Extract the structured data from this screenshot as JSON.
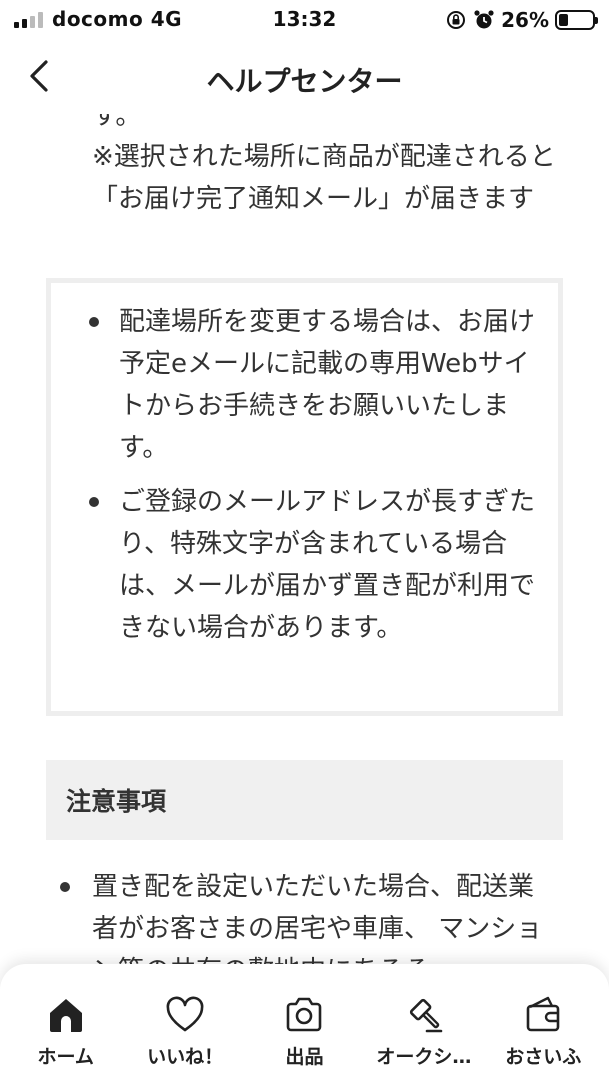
{
  "status_bar": {
    "carrier": "docomo  4G",
    "time": "13:32",
    "battery_percent": "26%",
    "battery_level": 0.26,
    "icons": [
      "signal-icon",
      "orientation-lock-icon",
      "alarm-icon",
      "battery-icon"
    ]
  },
  "header": {
    "title": "ヘルプセンター",
    "back_icon": "chevron-left-icon"
  },
  "content": {
    "cut_line": "す。",
    "note": "※選択された場所に商品が配達されると「お届け完了通知メール」が届きます",
    "info_box": {
      "items": [
        "配達場所を変更する場合は、お届け予定eメールに記載の専用Webサイトからお手続きをお願いいたします。",
        "ご登録のメールアドレスが長すぎたり、特殊文字が含まれている場合は、メールが届かず置き配が利用できない場合があります。"
      ]
    },
    "section": {
      "title": "注意事項"
    },
    "caution_items": [
      "置き配を設定いただいた場合、配送業者がお客さまの居宅や車庫、 マンション等の共有の敷地内にあるそ"
    ]
  },
  "tab_bar": {
    "active_color": "#222222",
    "tabs": [
      {
        "label": "ホーム",
        "icon": "home-icon"
      },
      {
        "label": "いいね！",
        "icon": "heart-icon"
      },
      {
        "label": "出品",
        "icon": "camera-icon"
      },
      {
        "label": "オークシ…",
        "icon": "gavel-icon"
      },
      {
        "label": "おさいふ",
        "icon": "wallet-icon"
      }
    ]
  }
}
